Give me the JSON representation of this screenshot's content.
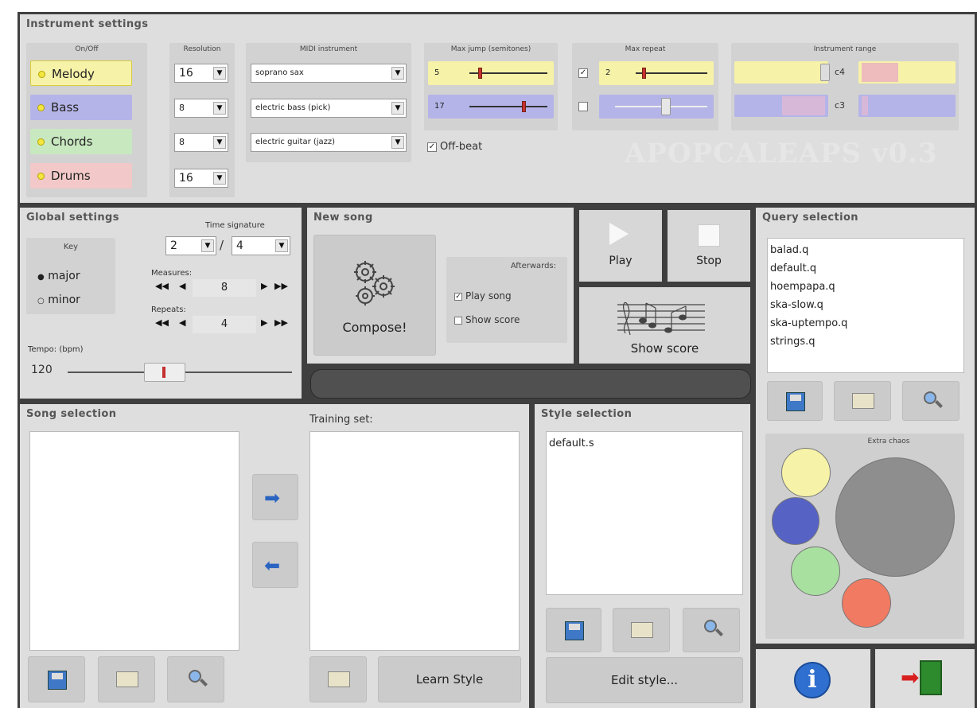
{
  "instrument_settings": {
    "title": "Instrument settings",
    "headers": {
      "onoff": "On/Off",
      "resolution": "Resolution",
      "midi": "MIDI instrument",
      "maxjump": "Max jump (semitones)",
      "maxrepeat": "Max repeat",
      "range": "Instrument range"
    },
    "rows": [
      {
        "name": "Melody",
        "color": "#f6f2a8",
        "resolution": "16",
        "midi": "soprano sax",
        "jump": "5",
        "repeat": "2",
        "range_note": "c4"
      },
      {
        "name": "Bass",
        "color": "#b4b4e8",
        "resolution": "8",
        "midi": "electric bass (pick)",
        "jump": "17",
        "range_note": "c3"
      },
      {
        "name": "Chords",
        "color": "#c8e8c0",
        "resolution": "8",
        "midi": "electric guitar (jazz)"
      },
      {
        "name": "Drums",
        "color": "#f2c8c8",
        "resolution": "16"
      }
    ],
    "offbeat_label": "Off-beat",
    "logo": "APOPCALEAPS v0.3"
  },
  "global": {
    "title": "Global settings",
    "time_sig_label": "Time signature",
    "time_num": "2",
    "time_den": "4",
    "slash": "/",
    "key_label": "Key",
    "major": "major",
    "minor": "minor",
    "measures_label": "Measures:",
    "measures": "8",
    "repeats_label": "Repeats:",
    "repeats": "4",
    "tempo_label": "Tempo:",
    "tempo_unit": "(bpm)",
    "tempo": "120"
  },
  "new_song": {
    "title": "New song",
    "compose": "Compose!",
    "afterwards": "Afterwards:",
    "play_song": "Play song",
    "show_score": "Show score"
  },
  "transport": {
    "play": "Play",
    "stop": "Stop",
    "show_score": "Show score"
  },
  "query": {
    "title": "Query selection",
    "items": [
      "balad.q",
      "default.q",
      "hoempapa.q",
      "ska-slow.q",
      "ska-uptempo.q",
      "strings.q"
    ],
    "extra_chaos": "Extra chaos"
  },
  "song": {
    "title": "Song selection",
    "training": "Training set:",
    "learn": "Learn Style"
  },
  "style": {
    "title": "Style selection",
    "items": [
      "default.s"
    ],
    "edit": "Edit style..."
  }
}
